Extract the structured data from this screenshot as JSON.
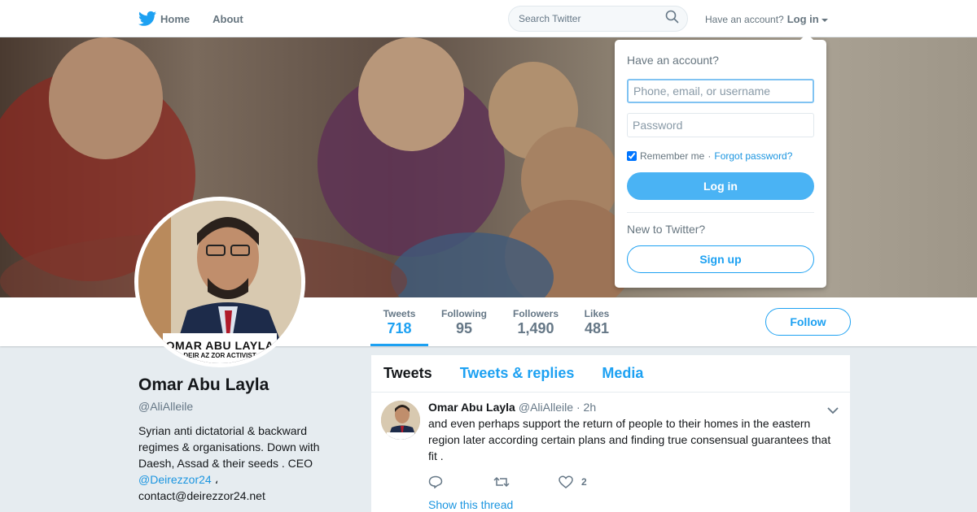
{
  "nav": {
    "home": "Home",
    "about": "About",
    "search_placeholder": "Search Twitter",
    "have_account": "Have an account?",
    "login": "Log in"
  },
  "profile": {
    "name": "Omar Abu Layla",
    "handle": "@AliAlleile",
    "bio_text": "Syrian anti dictatorial & backward regimes & organisations. Down with Daesh, Assad & their seeds . CEO",
    "bio_mention": "@Deirezzor24",
    "bio_separator": "،",
    "bio_email": "contact@deirezzor24.net",
    "avatar_caption_line1": "OMAR ABU LAYLA",
    "avatar_caption_line2": "DEIR AZ ZOR ACTIVIST",
    "follow_button": "Follow"
  },
  "stats": [
    {
      "label": "Tweets",
      "value": "718"
    },
    {
      "label": "Following",
      "value": "95"
    },
    {
      "label": "Followers",
      "value": "1,490"
    },
    {
      "label": "Likes",
      "value": "481"
    }
  ],
  "timeline_tabs": [
    "Tweets",
    "Tweets & replies",
    "Media"
  ],
  "tweet": {
    "name": "Omar Abu Layla",
    "handle": "@AliAlleile",
    "time": "· 2h",
    "text": "and even perhaps support the return of people to their homes in the eastern region later according certain plans and finding true consensual guarantees that fit .",
    "like_count": "2",
    "show_thread": "Show this thread"
  },
  "login_dropdown": {
    "heading": "Have an account?",
    "username_placeholder": "Phone, email, or username",
    "password_placeholder": "Password",
    "remember_me": "Remember me",
    "separator": "·",
    "forgot_password": "Forgot password?",
    "login_button": "Log in",
    "new_to_twitter": "New to Twitter?",
    "signup_button": "Sign up",
    "remember_checked": true
  },
  "colors": {
    "accent": "#1da1f2",
    "link": "#1b95e0",
    "background": "#e6ecf0"
  }
}
